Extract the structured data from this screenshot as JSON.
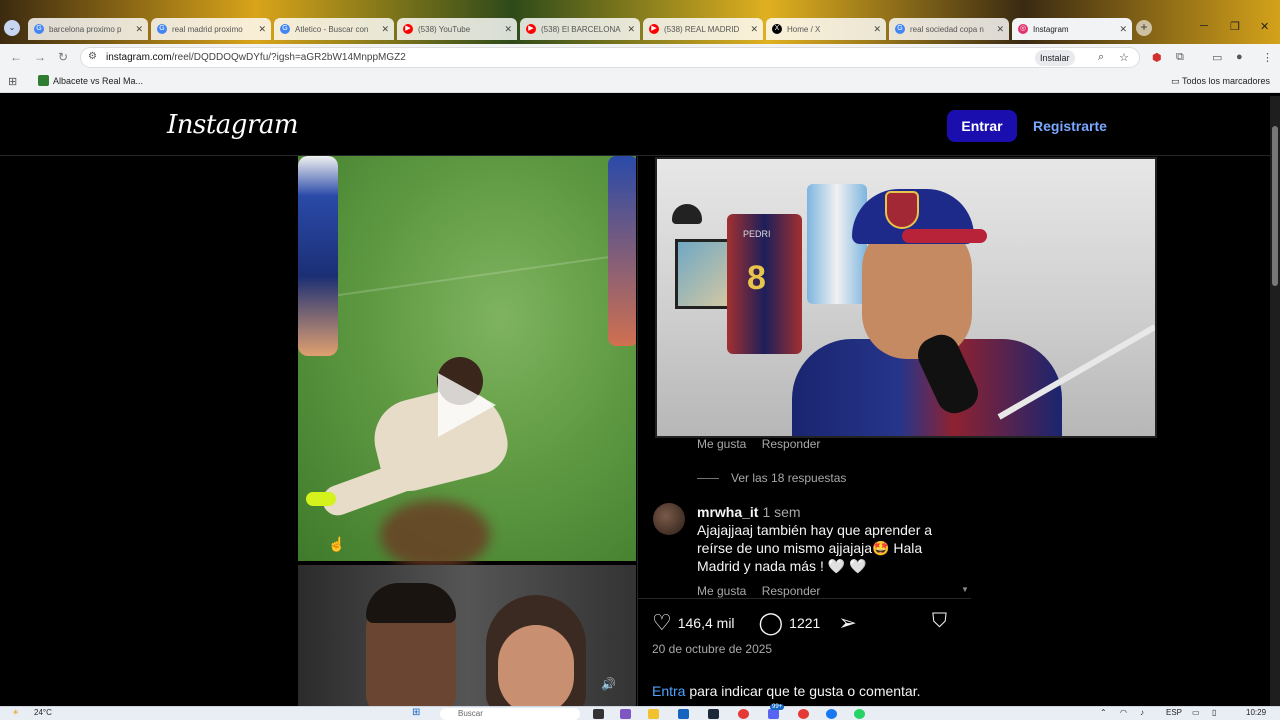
{
  "browser": {
    "tabs": [
      {
        "title": "barcelona proximo p",
        "icon": "google-icon",
        "color": "#4285f4"
      },
      {
        "title": "real madrid proximo",
        "icon": "google-icon",
        "color": "#4285f4"
      },
      {
        "title": "Atletico - Buscar con",
        "icon": "google-icon",
        "color": "#4285f4"
      },
      {
        "title": "(538) YouTube",
        "icon": "youtube-icon",
        "color": "#ff0000"
      },
      {
        "title": "(538) El BARCELONA",
        "icon": "youtube-icon",
        "color": "#ff0000"
      },
      {
        "title": "(538) REAL MADRID",
        "icon": "youtube-icon",
        "color": "#ff0000"
      },
      {
        "title": "Home / X",
        "icon": "x-icon",
        "color": "#000000"
      },
      {
        "title": "real sociedad copa n",
        "icon": "google-icon",
        "color": "#4285f4"
      },
      {
        "title": "Instagram",
        "icon": "instagram-icon",
        "color": "#e1306c"
      }
    ],
    "url_host": "instagram.com",
    "url_path": "/reel/DQDDOQwDYfu/?igsh=aGR2bW14MnppMGZ2",
    "install_label": "Instalar",
    "bookmark": "Albacete vs Real Ma...",
    "all_bookmarks": "Todos los marcadores"
  },
  "instagram": {
    "logo": "Instagram",
    "login_label": "Entrar",
    "register_label": "Registrarte",
    "comment1_like": "Me gusta",
    "comment1_reply": "Responder",
    "view_replies": "Ver las 18 respuestas",
    "comment2": {
      "user": "mrwha_it",
      "time": "1 sem",
      "text": "Ajajajjaaj también hay que aprender a reírse de uno mismo ajjajaja🤩 Hala Madrid y nada más ! 🤍 🤍",
      "like": "Me gusta",
      "reply": "Responder"
    },
    "likes": "146,4 mil",
    "comments": "1221",
    "date": "20 de octubre de 2025",
    "login_prompt_link": "Entra",
    "login_prompt_text": " para indicar que te gusta o comentar."
  },
  "webcam": {
    "jersey_name": "PEDRI",
    "jersey_number": "8"
  },
  "taskbar": {
    "weather": "24°C",
    "search_placeholder": "Buscar",
    "language": "ESP",
    "time": "10:29",
    "badge": "99+"
  }
}
